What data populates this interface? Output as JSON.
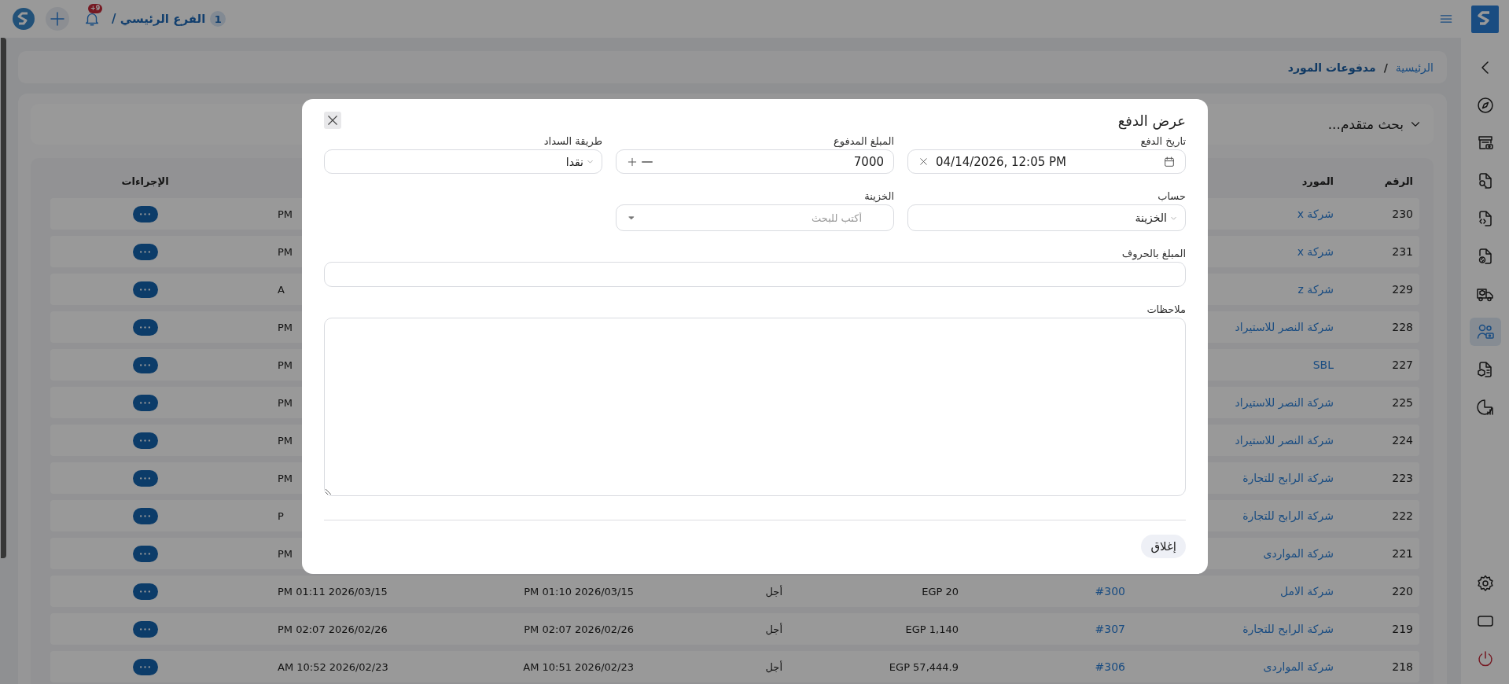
{
  "top_bar": {
    "branch": {
      "number": "1",
      "name": "الفرع الرئيسي /"
    },
    "notifications": {
      "badge": "+9"
    }
  },
  "sidebar": {
    "items": [
      {
        "selected": false
      },
      {
        "selected": false
      },
      {
        "selected": false
      },
      {
        "selected": false
      },
      {
        "selected": false
      },
      {
        "selected": false
      },
      {
        "selected": true
      },
      {
        "selected": false
      },
      {
        "selected": false
      }
    ]
  },
  "breadcrumb": {
    "items": [
      {
        "label": "الرئيسية",
        "current": false
      },
      {
        "label": "مدفوعات المورد",
        "current": true
      }
    ],
    "separator": "/"
  },
  "search_panel": {
    "title": "بحث متقدم...",
    "expanded": false
  },
  "table": {
    "columns": {
      "column_1": "الرقم",
      "column_2": "المورد",
      "column_8": "الإجراءات"
    },
    "rows": [
      {
        "column_1": "230",
        "column_2": "شركة x",
        "column_7": "PM"
      },
      {
        "column_1": "231",
        "column_2": "شركة x",
        "column_7": "PM"
      },
      {
        "column_1": "229",
        "column_2": "شركة z",
        "column_7": "A"
      },
      {
        "column_1": "228",
        "column_2": "شركة النصر للاستيراد",
        "column_7": "PM"
      },
      {
        "column_1": "227",
        "column_2": "SBL",
        "column_7": "PM"
      },
      {
        "column_1": "225",
        "column_2": "شركة النصر للاستيراد",
        "column_7": "PM"
      },
      {
        "column_1": "224",
        "column_2": "شركة النصر للاستيراد",
        "column_7": "PM"
      },
      {
        "column_1": "223",
        "column_2": "شركة الرابح للتجارة",
        "column_7": "PM"
      },
      {
        "column_1": "222",
        "column_2": "شركة الرابح للتجارة",
        "column_7": "P"
      },
      {
        "column_1": "221",
        "column_2": "شركة المواردى",
        "column_7": "PM"
      },
      {
        "column_1": "220",
        "column_2": "شركة الامل",
        "column_3": "#300",
        "column_4": "EGP 20",
        "column_5": "أجل",
        "column_6": "PM 01:10 2026/03/15",
        "column_7": "PM 01:11 2026/03/15"
      },
      {
        "column_1": "219",
        "column_2": "شركة الرابح للتجارة",
        "column_3": "#307",
        "column_4": "EGP 1,140",
        "column_5": "أجل",
        "column_6": "PM 02:07 2026/02/26",
        "column_7": "PM 02:07 2026/02/26"
      },
      {
        "column_1": "218",
        "column_2": "شركة المواردى",
        "column_3": "#306",
        "column_4": "EGP 57,444.9",
        "column_5": "أجل",
        "column_6": "AM 10:51 2026/02/23",
        "column_7": "AM 10:52 2026/02/23"
      }
    ]
  },
  "modal": {
    "title": "عرض الدفع",
    "fields": [
      {
        "kind": "datetime",
        "label": "تاريخ الدفع",
        "value": "04/14/2026, 12:05 PM"
      },
      {
        "kind": "number",
        "label": "المبلغ المدفوع",
        "value": "7000"
      },
      {
        "kind": "select",
        "label": "طريقة السداد",
        "value": "نقدا"
      },
      {
        "kind": "select",
        "label": "حساب",
        "value": "الخزينة"
      },
      {
        "kind": "search_select",
        "label": "الخزينة",
        "placeholder": "أكتب للبحث"
      },
      {
        "kind": "text",
        "label": "المبلغ بالحروف"
      },
      {
        "kind": "textarea",
        "label": "ملاحظات"
      }
    ],
    "close_button": "إغلاق"
  }
}
